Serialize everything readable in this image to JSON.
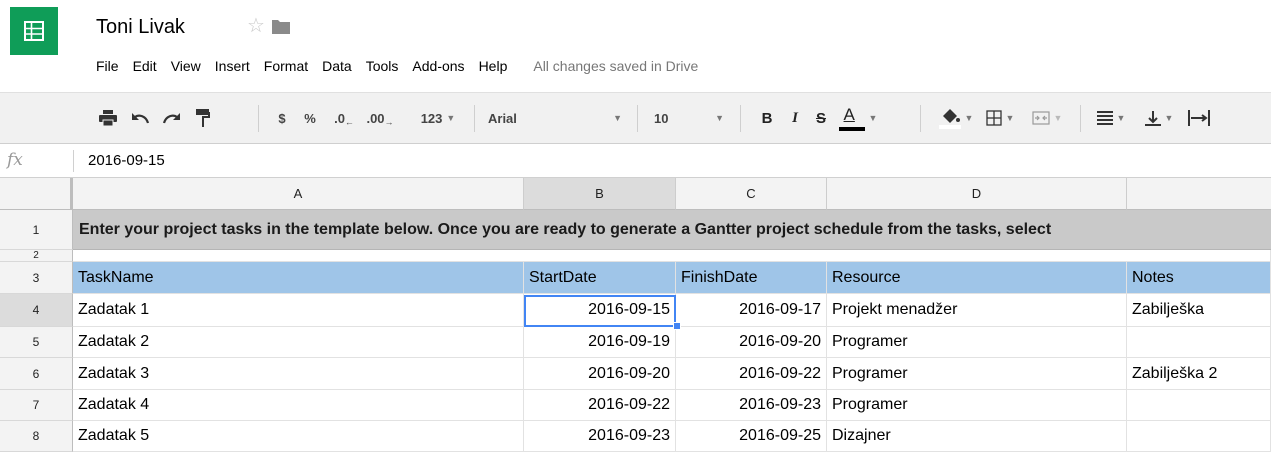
{
  "app": {
    "title": "Toni Livak",
    "save_status": "All changes saved in Drive",
    "brand_color": "#0f9d58",
    "icons": {
      "logo": "sheets-grid-icon",
      "star": "star-icon",
      "folder": "folder-icon"
    }
  },
  "menu": [
    "File",
    "Edit",
    "View",
    "Insert",
    "Format",
    "Data",
    "Tools",
    "Add-ons",
    "Help"
  ],
  "toolbar": {
    "currency": "$",
    "percent": "%",
    "decrease_decimals": ".0",
    "increase_decimals": ".00",
    "more_formats": "123",
    "font": "Arial",
    "font_size": "10",
    "bold": "B",
    "italic": "I",
    "strikethrough": "S",
    "text_color": "A",
    "icons": [
      "print-icon",
      "undo-icon",
      "redo-icon",
      "paint-format-icon",
      "fill-color-icon",
      "borders-icon",
      "merge-cells-icon",
      "align-left-icon",
      "align-bottom-icon",
      "text-wrap-icon"
    ]
  },
  "formula_bar": {
    "label": "fx",
    "value": "2016-09-15"
  },
  "columns": [
    "A",
    "B",
    "C",
    "D"
  ],
  "rows": [
    "1",
    "2",
    "3",
    "4",
    "5",
    "6",
    "7",
    "8"
  ],
  "banner": "Enter your project tasks in the template below.  Once you are ready to generate a Gantter project schedule from the tasks, select",
  "table": {
    "headers": [
      "TaskName",
      "StartDate",
      "FinishDate",
      "Resource",
      "Notes"
    ],
    "rows": [
      [
        "Zadatak 1",
        "2016-09-15",
        "2016-09-17",
        "Projekt menadžer",
        "Zabilješka"
      ],
      [
        "Zadatak 2",
        "2016-09-19",
        "2016-09-20",
        "Programer",
        ""
      ],
      [
        "Zadatak 3",
        "2016-09-20",
        "2016-09-22",
        "Programer",
        "Zabilješka 2"
      ],
      [
        "Zadatak 4",
        "2016-09-22",
        "2016-09-23",
        "Programer",
        ""
      ],
      [
        "Zadatak 5",
        "2016-09-23",
        "2016-09-25",
        "Dizajner",
        ""
      ]
    ]
  },
  "selected_cell": "B4"
}
